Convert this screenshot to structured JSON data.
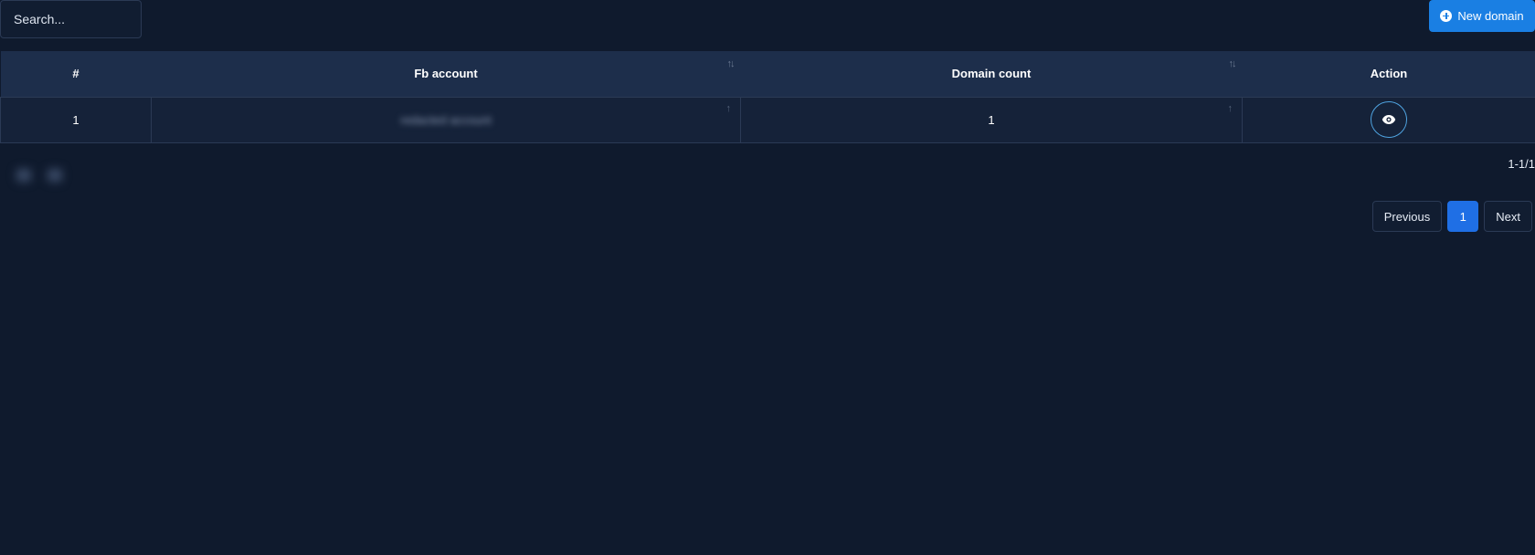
{
  "search": {
    "placeholder": "Search..."
  },
  "toolbar": {
    "new_label": "New domain"
  },
  "table": {
    "columns": [
      {
        "label": "#"
      },
      {
        "label": "Fb account"
      },
      {
        "label": "Domain count"
      },
      {
        "label": "Action"
      }
    ],
    "rows": [
      {
        "index": "1",
        "fb_account": "redacted account",
        "domain_count": "1"
      }
    ]
  },
  "pagination": {
    "range": "1-1/1",
    "previous": "Previous",
    "current": "1",
    "next": "Next"
  },
  "colors": {
    "accent": "#1a7fe3",
    "background": "#0f1a2d",
    "header": "#1d2e4b",
    "row": "#152239"
  }
}
